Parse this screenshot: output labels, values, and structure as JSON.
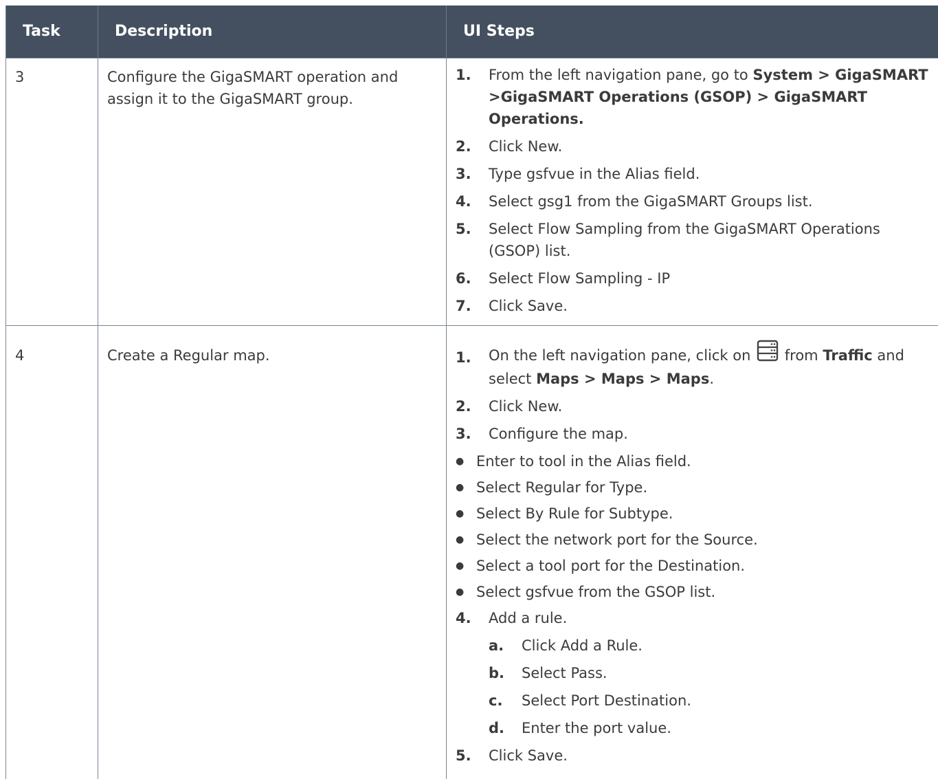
{
  "table": {
    "headers": [
      "Task",
      "Description",
      "UI Steps"
    ],
    "rows": [
      {
        "task": "3",
        "description": "Configure the GigaSMART operation and assign it to the GigaSMART group.",
        "steps": [
          {
            "num": "1.",
            "pre": "From the left navigation pane, go to ",
            "bold": "System > GigaSMART >GigaSMART Operations (GSOP) > GigaSMART Operations."
          },
          {
            "num": "2.",
            "text": "Click New."
          },
          {
            "num": "3.",
            "text": "Type gsfvue in the Alias field."
          },
          {
            "num": "4.",
            "text": "Select gsg1 from the GigaSMART Groups list."
          },
          {
            "num": "5.",
            "text": "Select Flow Sampling from the GigaSMART Operations (GSOP) list."
          },
          {
            "num": "6.",
            "text": "Select Flow Sampling - IP"
          },
          {
            "num": "7.",
            "text": "Click Save."
          }
        ]
      },
      {
        "task": "4",
        "description": "Create a Regular map.",
        "step1": {
          "num": "1.",
          "pre": "On the left navigation pane, click on ",
          "icon": "server-stack-icon",
          "mid": " from ",
          "bold1": "Traffic",
          "mid2": " and select ",
          "bold2": "Maps > Maps > Maps",
          "post": "."
        },
        "step2": {
          "num": "2.",
          "text": "Click New."
        },
        "step3": {
          "num": "3.",
          "text": "Configure the map."
        },
        "bullets": [
          "Enter to tool in the Alias field.",
          "Select Regular for Type.",
          "Select By Rule for Subtype.",
          "Select the network port for the Source.",
          "Select a tool port for the Destination.",
          "Select gsfvue from the GSOP list."
        ],
        "step4": {
          "num": "4.",
          "text": "Add a rule."
        },
        "substeps": [
          {
            "num": "a.",
            "text": "Click Add a Rule."
          },
          {
            "num": "b.",
            "text": "Select Pass."
          },
          {
            "num": "c.",
            "text": "Select Port Destination."
          },
          {
            "num": "d.",
            "text": "Enter the port value."
          }
        ],
        "step5": {
          "num": "5.",
          "text": "Click Save."
        }
      }
    ]
  },
  "colors": {
    "header_bg": "#44505f",
    "header_text": "#ffffff",
    "border": "#7b8594",
    "body_text": "#3b3b3b"
  }
}
